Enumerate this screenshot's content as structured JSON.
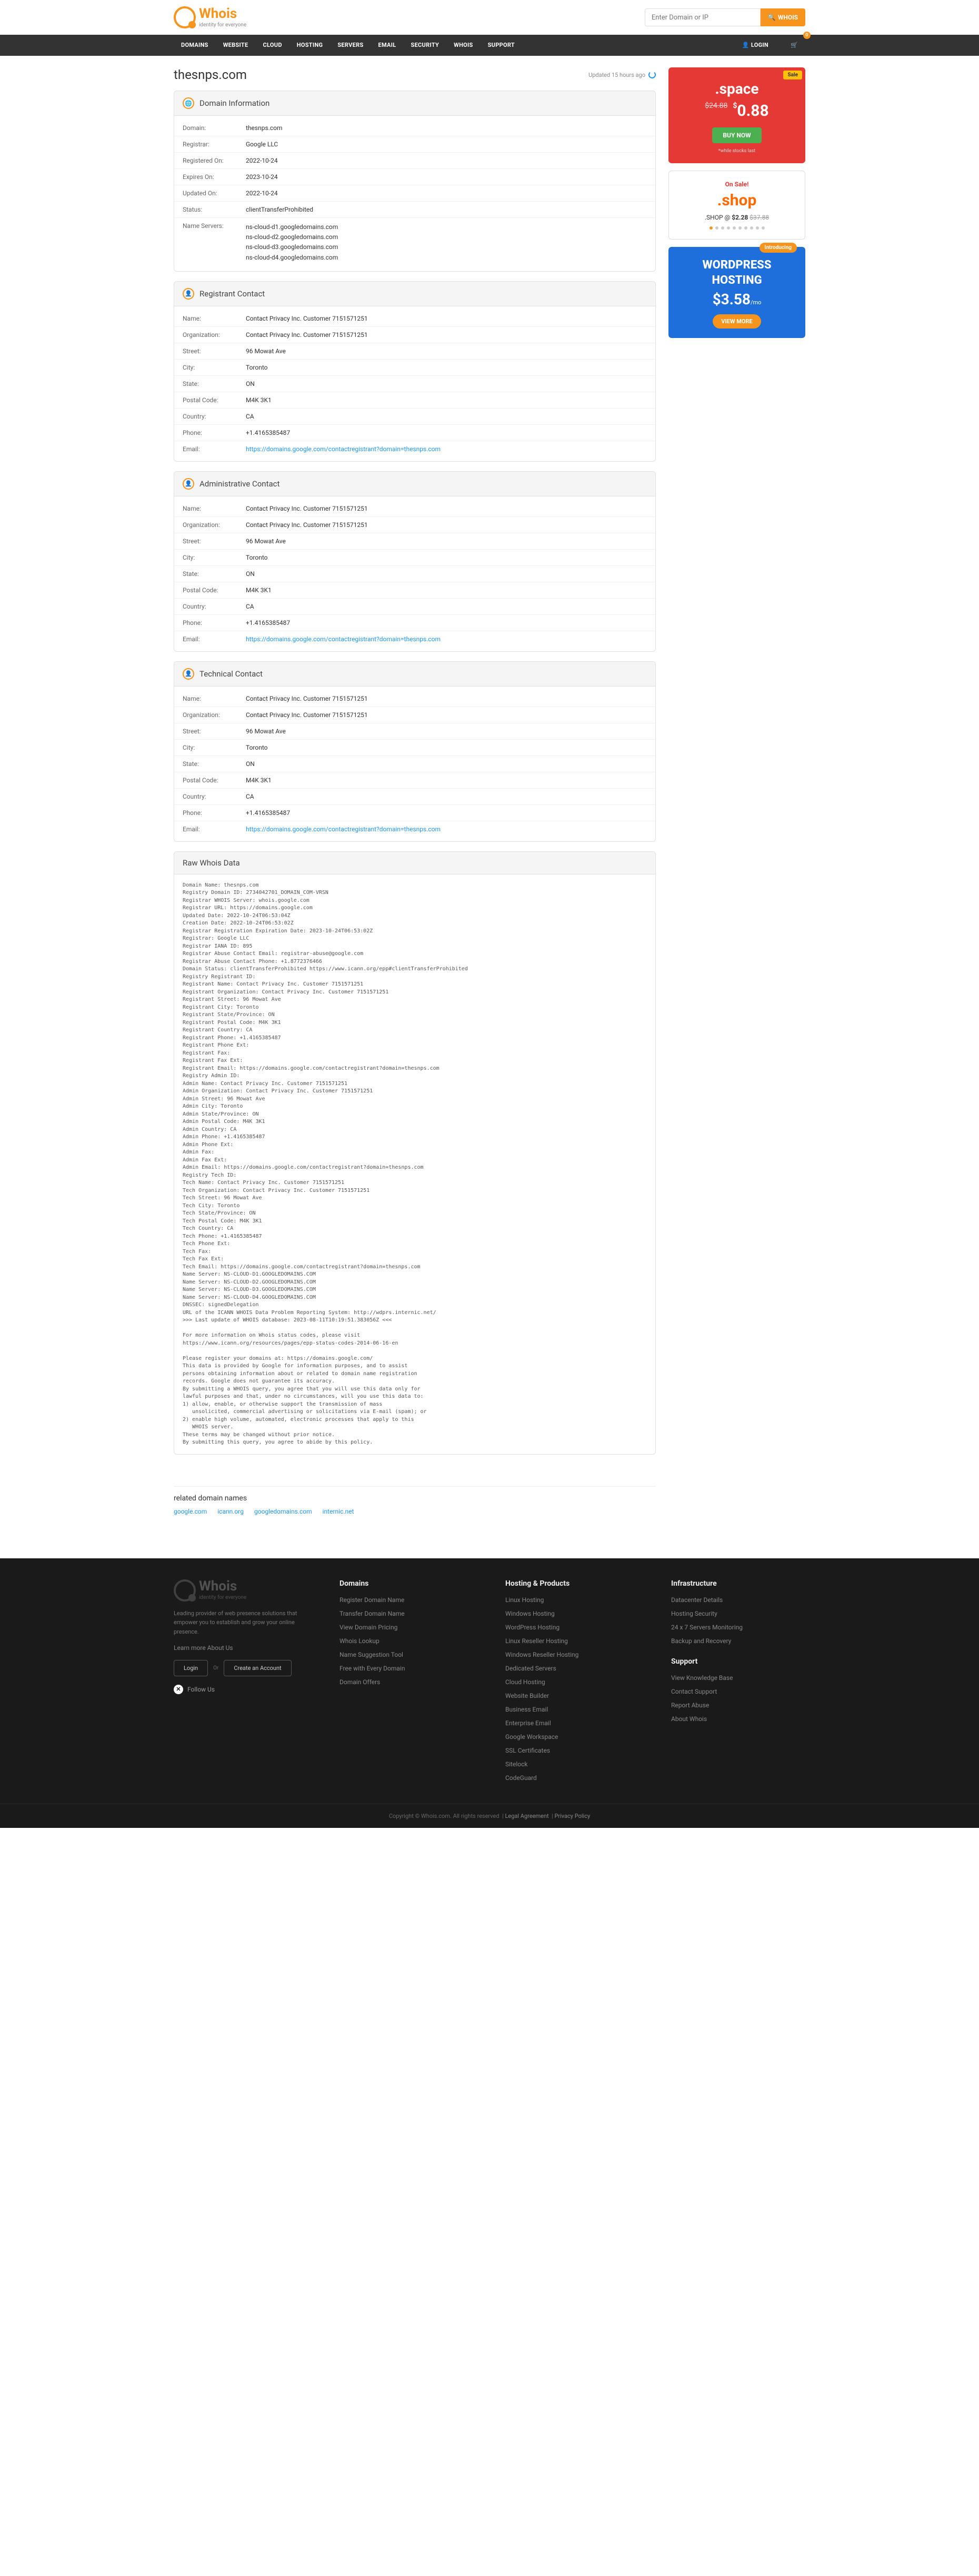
{
  "brand": {
    "name": "Whois",
    "tagline": "identity for everyone"
  },
  "search": {
    "placeholder": "Enter Domain or IP",
    "button": "WHOIS"
  },
  "nav": {
    "items": [
      "DOMAINS",
      "WEBSITE",
      "CLOUD",
      "HOSTING",
      "SERVERS",
      "EMAIL",
      "SECURITY",
      "WHOIS",
      "SUPPORT"
    ],
    "login": "LOGIN",
    "cart_count": "0"
  },
  "page": {
    "domain": "thesnps.com",
    "updated": "Updated 15 hours ago"
  },
  "panels": {
    "domain_info": {
      "title": "Domain Information",
      "rows": [
        {
          "k": "Domain:",
          "v": "thesnps.com"
        },
        {
          "k": "Registrar:",
          "v": "Google LLC"
        },
        {
          "k": "Registered On:",
          "v": "2022-10-24"
        },
        {
          "k": "Expires On:",
          "v": "2023-10-24"
        },
        {
          "k": "Updated On:",
          "v": "2022-10-24"
        },
        {
          "k": "Status:",
          "v": "clientTransferProhibited"
        },
        {
          "k": "Name Servers:",
          "v": [
            "ns-cloud-d1.googledomains.com",
            "ns-cloud-d2.googledomains.com",
            "ns-cloud-d3.googledomains.com",
            "ns-cloud-d4.googledomains.com"
          ]
        }
      ]
    },
    "registrant": {
      "title": "Registrant Contact",
      "rows": [
        {
          "k": "Name:",
          "v": "Contact Privacy Inc. Customer 7151571251"
        },
        {
          "k": "Organization:",
          "v": "Contact Privacy Inc. Customer 7151571251"
        },
        {
          "k": "Street:",
          "v": "96 Mowat Ave"
        },
        {
          "k": "City:",
          "v": "Toronto"
        },
        {
          "k": "State:",
          "v": "ON"
        },
        {
          "k": "Postal Code:",
          "v": "M4K 3K1"
        },
        {
          "k": "Country:",
          "v": "CA"
        },
        {
          "k": "Phone:",
          "v": "+1.4165385487"
        },
        {
          "k": "Email:",
          "v": "https://domains.google.com/contactregistrant?domain=thesnps.com",
          "link": true
        }
      ]
    },
    "admin": {
      "title": "Administrative Contact",
      "rows": [
        {
          "k": "Name:",
          "v": "Contact Privacy Inc. Customer 7151571251"
        },
        {
          "k": "Organization:",
          "v": "Contact Privacy Inc. Customer 7151571251"
        },
        {
          "k": "Street:",
          "v": "96 Mowat Ave"
        },
        {
          "k": "City:",
          "v": "Toronto"
        },
        {
          "k": "State:",
          "v": "ON"
        },
        {
          "k": "Postal Code:",
          "v": "M4K 3K1"
        },
        {
          "k": "Country:",
          "v": "CA"
        },
        {
          "k": "Phone:",
          "v": "+1.4165385487"
        },
        {
          "k": "Email:",
          "v": "https://domains.google.com/contactregistrant?domain=thesnps.com",
          "link": true
        }
      ]
    },
    "tech": {
      "title": "Technical Contact",
      "rows": [
        {
          "k": "Name:",
          "v": "Contact Privacy Inc. Customer 7151571251"
        },
        {
          "k": "Organization:",
          "v": "Contact Privacy Inc. Customer 7151571251"
        },
        {
          "k": "Street:",
          "v": "96 Mowat Ave"
        },
        {
          "k": "City:",
          "v": "Toronto"
        },
        {
          "k": "State:",
          "v": "ON"
        },
        {
          "k": "Postal Code:",
          "v": "M4K 3K1"
        },
        {
          "k": "Country:",
          "v": "CA"
        },
        {
          "k": "Phone:",
          "v": "+1.4165385487"
        },
        {
          "k": "Email:",
          "v": "https://domains.google.com/contactregistrant?domain=thesnps.com",
          "link": true
        }
      ]
    },
    "raw": {
      "title": "Raw Whois Data",
      "text": "Domain Name: thesnps.com\nRegistry Domain ID: 2734042701_DOMAIN_COM-VRSN\nRegistrar WHOIS Server: whois.google.com\nRegistrar URL: https://domains.google.com\nUpdated Date: 2022-10-24T06:53:04Z\nCreation Date: 2022-10-24T06:53:02Z\nRegistrar Registration Expiration Date: 2023-10-24T06:53:02Z\nRegistrar: Google LLC\nRegistrar IANA ID: 895\nRegistrar Abuse Contact Email: registrar-abuse@google.com\nRegistrar Abuse Contact Phone: +1.8772376466\nDomain Status: clientTransferProhibited https://www.icann.org/epp#clientTransferProhibited\nRegistry Registrant ID:\nRegistrant Name: Contact Privacy Inc. Customer 7151571251\nRegistrant Organization: Contact Privacy Inc. Customer 7151571251\nRegistrant Street: 96 Mowat Ave\nRegistrant City: Toronto\nRegistrant State/Province: ON\nRegistrant Postal Code: M4K 3K1\nRegistrant Country: CA\nRegistrant Phone: +1.4165385487\nRegistrant Phone Ext:\nRegistrant Fax:\nRegistrant Fax Ext:\nRegistrant Email: https://domains.google.com/contactregistrant?domain=thesnps.com\nRegistry Admin ID:\nAdmin Name: Contact Privacy Inc. Customer 7151571251\nAdmin Organization: Contact Privacy Inc. Customer 7151571251\nAdmin Street: 96 Mowat Ave\nAdmin City: Toronto\nAdmin State/Province: ON\nAdmin Postal Code: M4K 3K1\nAdmin Country: CA\nAdmin Phone: +1.4165385487\nAdmin Phone Ext:\nAdmin Fax:\nAdmin Fax Ext:\nAdmin Email: https://domains.google.com/contactregistrant?domain=thesnps.com\nRegistry Tech ID:\nTech Name: Contact Privacy Inc. Customer 7151571251\nTech Organization: Contact Privacy Inc. Customer 7151571251\nTech Street: 96 Mowat Ave\nTech City: Toronto\nTech State/Province: ON\nTech Postal Code: M4K 3K1\nTech Country: CA\nTech Phone: +1.4165385487\nTech Phone Ext:\nTech Fax:\nTech Fax Ext:\nTech Email: https://domains.google.com/contactregistrant?domain=thesnps.com\nName Server: NS-CLOUD-D1.GOOGLEDOMAINS.COM\nName Server: NS-CLOUD-D2.GOOGLEDOMAINS.COM\nName Server: NS-CLOUD-D3.GOOGLEDOMAINS.COM\nName Server: NS-CLOUD-D4.GOOGLEDOMAINS.COM\nDNSSEC: signedDelegation\nURL of the ICANN WHOIS Data Problem Reporting System: http://wdprs.internic.net/\n>>> Last update of WHOIS database: 2023-08-11T10:19:51.383056Z <<<\n\nFor more information on Whois status codes, please visit\nhttps://www.icann.org/resources/pages/epp-status-codes-2014-06-16-en\n\nPlease register your domains at: https://domains.google.com/\nThis data is provided by Google for information purposes, and to assist\npersons obtaining information about or related to domain name registration\nrecords. Google does not guarantee its accuracy.\nBy submitting a WHOIS query, you agree that you will use this data only for\nlawful purposes and that, under no circumstances, will you use this data to:\n1) allow, enable, or otherwise support the transmission of mass\n   unsolicited, commercial advertising or solicitations via E-mail (spam); or\n2) enable high volume, automated, electronic processes that apply to this\n   WHOIS server.\nThese terms may be changed without prior notice.\nBy submitting this query, you agree to abide by this policy."
    }
  },
  "promos": {
    "space": {
      "tag": "Sale",
      "tld": ".space",
      "old": "$24.88",
      "new": "0.88",
      "cur": "$",
      "btn": "BUY NOW",
      "fine": "*while stocks last"
    },
    "shop": {
      "tag": "On Sale!",
      "logo": ".shop",
      "line_pre": ".SHOP @ ",
      "price": "$2.28",
      "old": "$37.88"
    },
    "wp": {
      "tag": "Introducing",
      "t1": "WORDPRESS",
      "t2": "HOSTING",
      "cur": "$",
      "price": "3.58",
      "mo": "/mo",
      "btn": "VIEW MORE"
    }
  },
  "related": {
    "title": "related domain names",
    "links": [
      "google.com",
      "icann.org",
      "googledomains.com",
      "internic.net"
    ]
  },
  "footer": {
    "desc": "Leading provider of web presence solutions that empower you to establish and grow your online presence.",
    "learn": "Learn more About Us",
    "login": "Login",
    "or": "Or",
    "create": "Create an Account",
    "follow": "Follow Us",
    "cols": [
      {
        "title": "Domains",
        "links": [
          "Register Domain Name",
          "Transfer Domain Name",
          "View Domain Pricing",
          "Whois Lookup",
          "Name Suggestion Tool",
          "Free with Every Domain",
          "Domain Offers"
        ]
      },
      {
        "title": "Hosting & Products",
        "links": [
          "Linux Hosting",
          "Windows Hosting",
          "WordPress Hosting",
          "Linux Reseller Hosting",
          "Windows Reseller Hosting",
          "Dedicated Servers",
          "Cloud Hosting",
          "Website Builder",
          "Business Email",
          "Enterprise Email",
          "Google Workspace",
          "SSL Certificates",
          "Sitelock",
          "CodeGuard"
        ]
      },
      {
        "title": "Infrastructure",
        "links": [
          "Datacenter Details",
          "Hosting Security",
          "24 x 7 Servers Monitoring",
          "Backup and Recovery"
        ]
      },
      {
        "title": "Support",
        "links": [
          "View Knowledge Base",
          "Contact Support",
          "Report Abuse",
          "About Whois"
        ]
      }
    ],
    "copyright": "Copyright © Whois.com. All rights reserved",
    "legal": "Legal Agreement",
    "privacy": "Privacy Policy"
  }
}
